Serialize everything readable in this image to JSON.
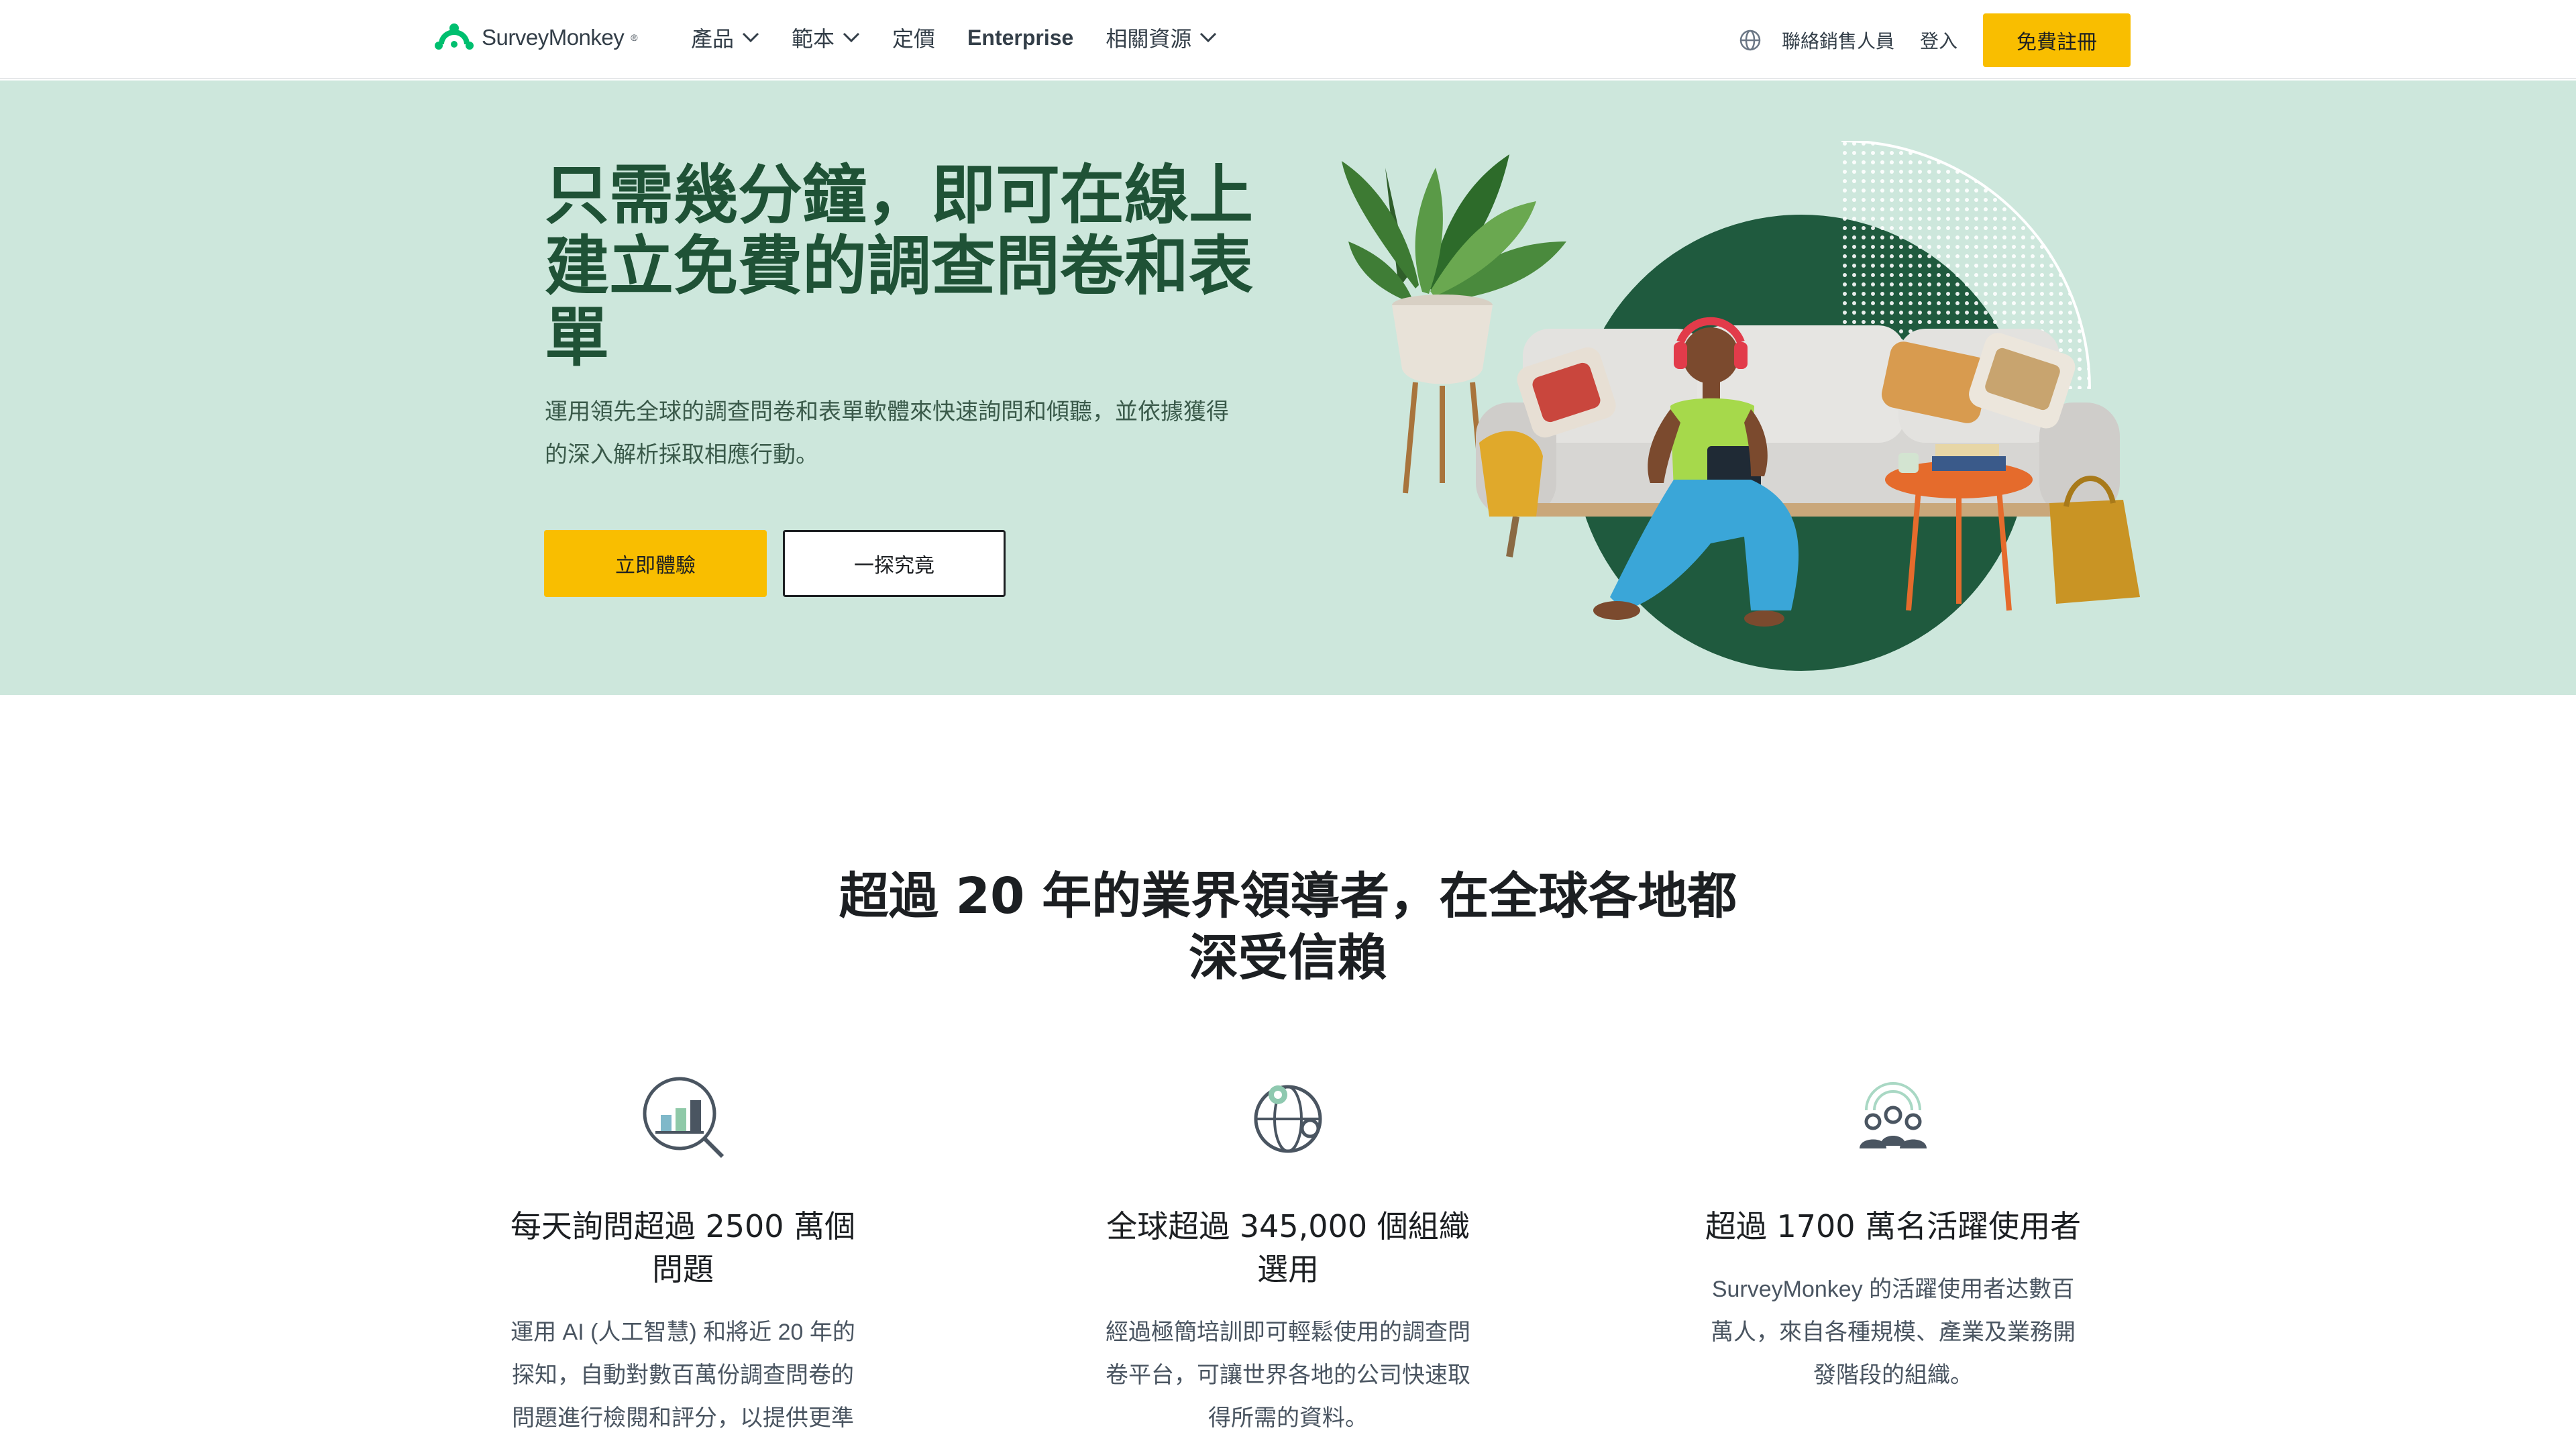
{
  "brand": {
    "name": "SurveyMonkey",
    "tm": "®",
    "color": "#00bf6f"
  },
  "nav": {
    "menu": [
      {
        "label": "產品",
        "has_dropdown": true
      },
      {
        "label": "範本",
        "has_dropdown": true
      },
      {
        "label": "定價",
        "has_dropdown": false
      },
      {
        "label": "Enterprise",
        "has_dropdown": false
      },
      {
        "label": "相關資源",
        "has_dropdown": true
      }
    ],
    "globe_icon": "globe-icon",
    "contact_sales": "聯絡銷售人員",
    "login": "登入",
    "signup": "免費註冊"
  },
  "hero": {
    "title_lines": [
      "只需幾分鐘，即可在線上",
      "建立免費的調查問卷和表",
      "單"
    ],
    "subtitle_lines": [
      "運用領先全球的調查問卷和表單軟體來快速詢問和傾聽，並依據獲得",
      "的深入解析採取相應行動。"
    ],
    "primary_button": "立即體驗",
    "secondary_button": "一探究竟",
    "background": "#cde7dc"
  },
  "trust": {
    "title_lines": [
      "超過 20 年的業界領導者，在全球各地都",
      "深受信賴"
    ],
    "features": [
      {
        "icon": "magnifier-chart-icon",
        "title_lines": [
          "每天詢問超過 2500 萬個",
          "問題"
        ],
        "desc_lines": [
          "運用 AI (人工智慧) 和將近 20 年的",
          "探知，自動對數百萬份調查問卷的",
          "問題進行檢閱和評分，以提供更準"
        ]
      },
      {
        "icon": "globe-pin-icon",
        "title_lines": [
          "全球超過 345,000 個組織",
          "選用"
        ],
        "desc_lines": [
          "經過極簡培訓即可輕鬆使用的調查問",
          "卷平台，可讓世界各地的公司快速取",
          "得所需的資料。"
        ]
      },
      {
        "icon": "users-signal-icon",
        "title_lines": [
          "超過 1700 萬名活躍使用者"
        ],
        "desc_lines": [
          "SurveyMonkey 的活躍使用者达數百",
          "萬人，來自各種規模、產業及業務開",
          "發階段的組織。"
        ]
      }
    ]
  }
}
